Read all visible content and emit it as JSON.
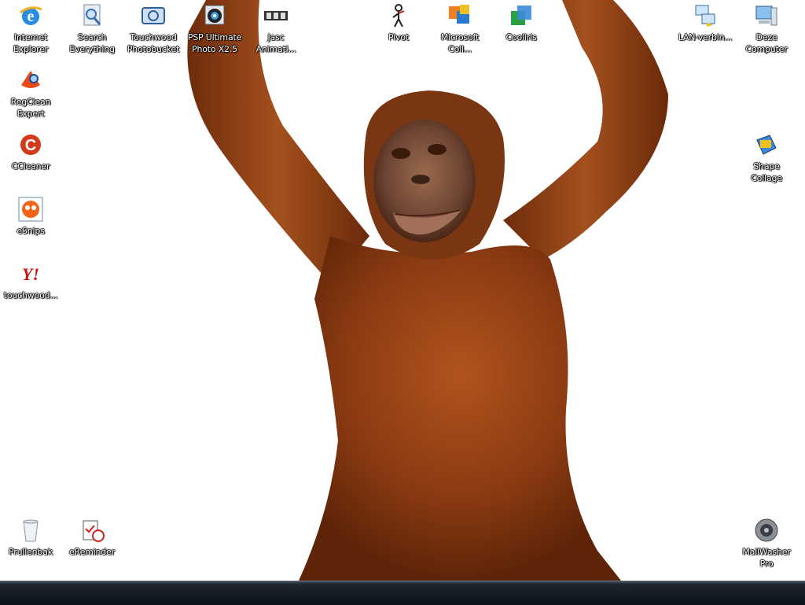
{
  "colors": {
    "label_text": "#ffffff",
    "taskbar": "#111a20",
    "fur": "#8a3a12"
  },
  "desktop": {
    "icons_left": [
      {
        "label": "Internet\nExplorer",
        "icon": "internet-explorer-icon"
      },
      {
        "label": "Search\nEverything",
        "icon": "search-everything-icon"
      },
      {
        "label": "Touchwood\nPhotobucket",
        "icon": "touchwood-photobucket-icon"
      },
      {
        "label": "PSP Ultimate\nPhoto X2.5",
        "icon": "psp-ultimate-icon"
      },
      {
        "label": "Jasc\nAnimati...",
        "icon": "jasc-animation-icon"
      },
      {
        "label": "RegClean\nExpert",
        "icon": "regclean-expert-icon"
      },
      {
        "label": "CCleaner",
        "icon": "ccleaner-icon"
      },
      {
        "label": "eSnips",
        "icon": "esnips-icon"
      },
      {
        "label": "touchwood...",
        "icon": "yahoo-touchwood-icon"
      }
    ],
    "icons_top_middle": [
      {
        "label": "Pivot",
        "icon": "pivot-stickfigure-icon"
      },
      {
        "label": "Microsoft Coll...",
        "icon": "microsoft-collage-icon"
      },
      {
        "label": "Cooliris",
        "icon": "cooliris-icon"
      }
    ],
    "icons_right": [
      {
        "label": "LAN-verbin...",
        "icon": "lan-connection-icon"
      },
      {
        "label": "Deze\nComputer",
        "icon": "computer-icon"
      },
      {
        "label": "Shape\nCollage",
        "icon": "shape-collage-icon"
      },
      {
        "label": "MailWasher\nPro",
        "icon": "mailwasher-pro-icon"
      }
    ],
    "icons_bottom_left": [
      {
        "label": "Prullenbak",
        "icon": "recycle-bin-icon"
      },
      {
        "label": "eReminder",
        "icon": "ereminder-icon"
      }
    ]
  }
}
